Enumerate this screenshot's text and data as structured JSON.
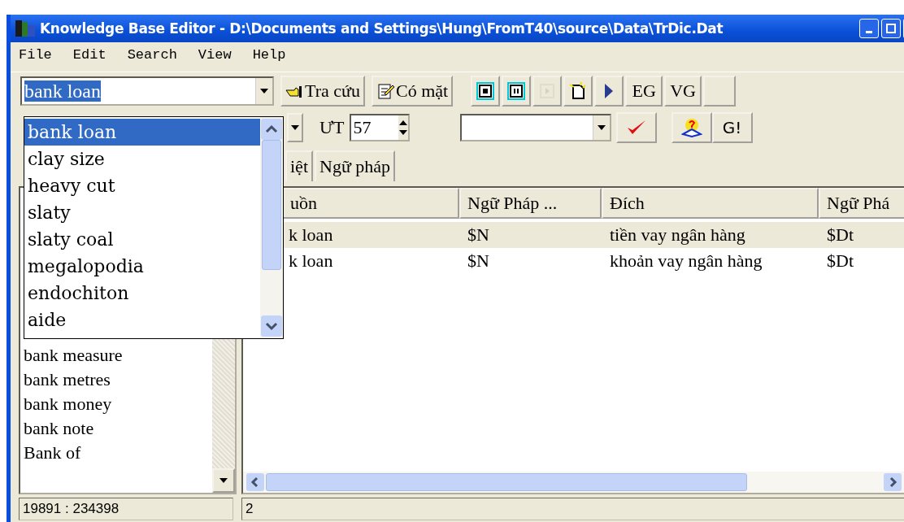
{
  "window": {
    "title": "Knowledge Base Editor - D:\\Documents and Settings\\Hung\\FromT40\\source\\Data\\TrDic.Dat"
  },
  "menu": [
    "File",
    "Edit",
    "Search",
    "View",
    "Help"
  ],
  "toolbar": {
    "search": {
      "value": "bank loan"
    },
    "buttons": [
      {
        "label": "Tra cứu"
      },
      {
        "label": "Có mặt"
      }
    ],
    "tools": [
      {
        "kind": "icon",
        "disabled": false
      },
      {
        "kind": "icon",
        "disabled": false
      },
      {
        "kind": "icon",
        "disabled": true
      },
      {
        "kind": "icon",
        "disabled": false
      },
      {
        "kind": "icon",
        "disabled": false
      },
      {
        "kind": "text",
        "label": "EG"
      },
      {
        "kind": "text",
        "label": "VG"
      },
      {
        "kind": "blank"
      }
    ]
  },
  "toolbar2": {
    "label": "ƯT",
    "spin_value": "57",
    "go_button": "G!"
  },
  "dropdown": {
    "items": [
      {
        "label": "bank loan",
        "selected": true
      },
      {
        "label": "clay size",
        "selected": false
      },
      {
        "label": "heavy cut",
        "selected": false
      },
      {
        "label": "slaty",
        "selected": false
      },
      {
        "label": "slaty coal",
        "selected": false
      },
      {
        "label": "megalopodia",
        "selected": false
      },
      {
        "label": "endochiton",
        "selected": false
      },
      {
        "label": "aide",
        "selected": false
      }
    ]
  },
  "tabs": [
    {
      "label": "iệt",
      "selected": false
    },
    {
      "label": "Ngữ pháp",
      "selected": false
    }
  ],
  "word_list": {
    "items": [
      {
        "label": "bank measure",
        "selected": false
      },
      {
        "label": "bank metres",
        "selected": false
      },
      {
        "label": "bank money",
        "selected": false
      },
      {
        "label": "bank note",
        "selected": false
      },
      {
        "label": "Bank of",
        "selected": false
      }
    ]
  },
  "table": {
    "columns": [
      "uồn",
      "Ngữ Pháp ...",
      "Đích",
      "Ngữ Phá"
    ],
    "rows": [
      {
        "cells": [
          "k loan",
          "$N",
          "tiền vay ngân hàng",
          "$Dt"
        ],
        "selected": true
      },
      {
        "cells": [
          "k loan",
          "$N",
          "khoản vay ngân hàng",
          "$Dt"
        ],
        "selected": false
      }
    ]
  },
  "status_bar": [
    "19891 : 234398",
    "2"
  ]
}
